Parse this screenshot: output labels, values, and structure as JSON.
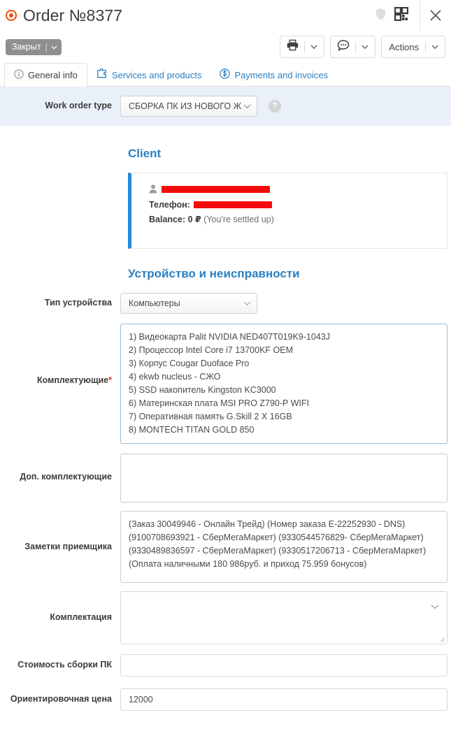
{
  "header": {
    "title": "Order №8377",
    "status_icon": "order-status-dot-icon",
    "shield_icon": "shield-icon",
    "qr_icon": "qr-code-icon",
    "close_icon": "close-icon"
  },
  "toolbar": {
    "status_badge": "Закрыт",
    "status_separator": "|",
    "print_icon": "printer-icon",
    "comment_icon": "comment-bubble-icon",
    "actions_label": "Actions",
    "chevron_icon": "chevron-down-icon"
  },
  "tabs": [
    {
      "label": "General info",
      "icon": "info-circle-icon",
      "active": true
    },
    {
      "label": "Services and products",
      "icon": "puzzle-piece-icon",
      "active": false
    },
    {
      "label": "Payments and invoices",
      "icon": "dollar-circle-icon",
      "active": false
    }
  ],
  "work_order": {
    "label": "Work order type",
    "value": "СБОРКА ПК ИЗ НОВОГО Ж",
    "help_icon": "question-mark-icon",
    "help_glyph": "?",
    "chevron_icon": "chevron-down-icon"
  },
  "client": {
    "section_title": "Client",
    "person_icon": "person-icon",
    "name_redacted": true,
    "phone_label": "Телефон:",
    "phone_redacted": true,
    "balance_label": "Balance:",
    "balance_value": "0 ₽",
    "balance_note": "(You're settled up)"
  },
  "device": {
    "section_title": "Устройство и неисправности",
    "device_type_label": "Тип устройства",
    "device_type_value": "Компьютеры",
    "chevron_icon": "chevron-down-icon"
  },
  "fields": {
    "components_label": "Комплектующие",
    "components_required": "*",
    "components_value": "1) Видеокарта Palit NVIDIA NED407T019K9-1043J\n2) Процессор Intel Core i7 13700KF OEM\n3) Корпус Cougar Duoface Pro\n4) ekwb nucleus - СЖО\n5) SSD накопитель Kingston KC3000\n6) Материнская плата MSI PRO Z790-P WIFI\n7) Оперативная память G.Skill 2 X 16GB\n8) MONTECH TITAN GOLD 850",
    "extra_components_label": "Доп. комплектующие",
    "extra_components_value": "",
    "receiver_notes_label": "Заметки приемщика",
    "receiver_notes_value": "(Заказ 30049946 - Онлайн Трейд) (Номер заказа E-22252930 - DNS) (9100708693921 - СберМегаМаркет) (9330544576829- СберМегаМаркет) (9330489836597   - СберМегаМаркет) (9330517206713 - СберМегаМаркет) (Оплата наличными 180 986руб. и приход 75.959 бонусов)",
    "configuration_label": "Комплектация",
    "configuration_value": "",
    "assembly_cost_label": "Стоимость сборки ПК",
    "assembly_cost_value": "",
    "estimated_price_label": "Ориентировочная цена",
    "estimated_price_value": "12000"
  },
  "colors": {
    "accent_blue": "#2b7fc0",
    "brand_orange": "#e8500e",
    "band_blue": "#e9f0fa",
    "badge_gray": "#8d8f91",
    "redaction_red": "#f40b0b",
    "required_red": "#e02d2d"
  }
}
